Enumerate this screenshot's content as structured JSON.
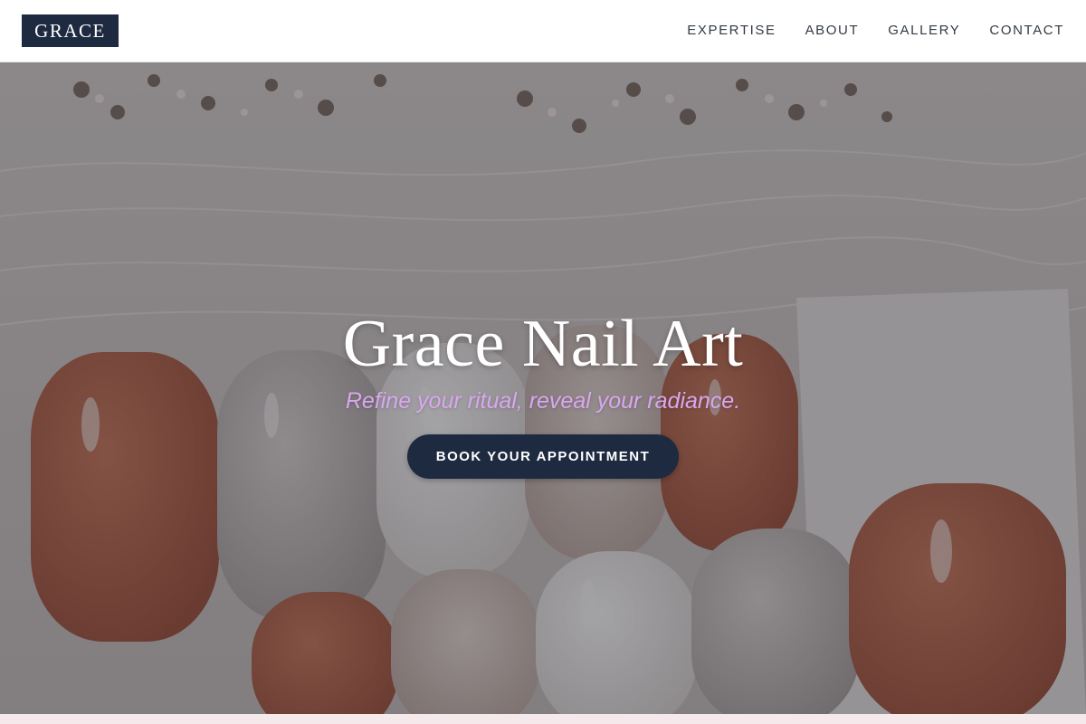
{
  "brand": {
    "logo_text": "GRACE",
    "accent_color": "#1e2a40"
  },
  "nav": {
    "items": [
      {
        "label": "EXPERTISE"
      },
      {
        "label": "ABOUT"
      },
      {
        "label": "GALLERY"
      },
      {
        "label": "CONTACT"
      }
    ]
  },
  "hero": {
    "title": "Grace Nail Art",
    "subtitle": "Refine your ritual, reveal your radiance.",
    "subtitle_color": "#d9a7f0",
    "cta_label": "BOOK YOUR APPOINTMENT",
    "background_image": "nail-art-photo"
  }
}
